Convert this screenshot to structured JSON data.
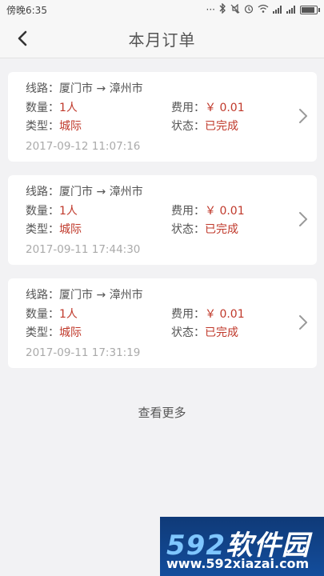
{
  "status_bar": {
    "time": "傍晚6:35",
    "icons": [
      "dots-icon",
      "bluetooth-icon",
      "mute-icon",
      "alarm-icon",
      "wifi-icon",
      "signal-icon",
      "signal-icon",
      "battery-icon"
    ]
  },
  "navbar": {
    "back_icon": "chevron-left-icon",
    "title": "本月订单"
  },
  "orders": [
    {
      "route_label": "线路：",
      "route": "厦门市 → 漳州市",
      "qty_label": "数量：",
      "qty": "1人",
      "fee_label": "费用：",
      "fee": "￥ 0.01",
      "type_label": "类型：",
      "type": "城际",
      "status_label": "状态：",
      "status": "已完成",
      "timestamp": "2017-09-12 11:07:16"
    },
    {
      "route_label": "线路：",
      "route": "厦门市 → 漳州市",
      "qty_label": "数量：",
      "qty": "1人",
      "fee_label": "费用：",
      "fee": "￥ 0.01",
      "type_label": "类型：",
      "type": "城际",
      "status_label": "状态：",
      "status": "已完成",
      "timestamp": "2017-09-11 17:44:30"
    },
    {
      "route_label": "线路：",
      "route": "厦门市 → 漳州市",
      "qty_label": "数量：",
      "qty": "1人",
      "fee_label": "费用：",
      "fee": "￥ 0.01",
      "type_label": "类型：",
      "type": "城际",
      "status_label": "状态：",
      "status": "已完成",
      "timestamp": "2017-09-11 17:31:19"
    }
  ],
  "load_more": "查看更多",
  "watermark": {
    "brand_num": "592",
    "brand_text": "软件园",
    "url": "www.592xiazai.com"
  },
  "colors": {
    "accent_red": "#c0392b",
    "background": "#f2f2f4",
    "card": "#ffffff"
  }
}
